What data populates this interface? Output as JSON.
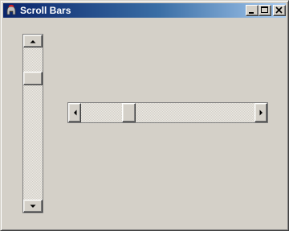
{
  "window": {
    "title": "Scroll Bars",
    "app_icon": "spartan-helmet-icon",
    "controls": {
      "minimize_icon": "minimize-icon",
      "maximize_icon": "maximize-icon",
      "close_icon": "close-icon"
    }
  },
  "vertical_scrollbar": {
    "up_arrow_icon": "arrow-up-icon",
    "down_arrow_icon": "arrow-down-icon",
    "position_fraction": 0.24
  },
  "horizontal_scrollbar": {
    "left_arrow_icon": "arrow-left-icon",
    "right_arrow_icon": "arrow-right-icon",
    "position_fraction": 0.28
  },
  "colors": {
    "face": "#d4d0c8",
    "titlebar_start": "#0a246a",
    "titlebar_end": "#a6caf0"
  }
}
